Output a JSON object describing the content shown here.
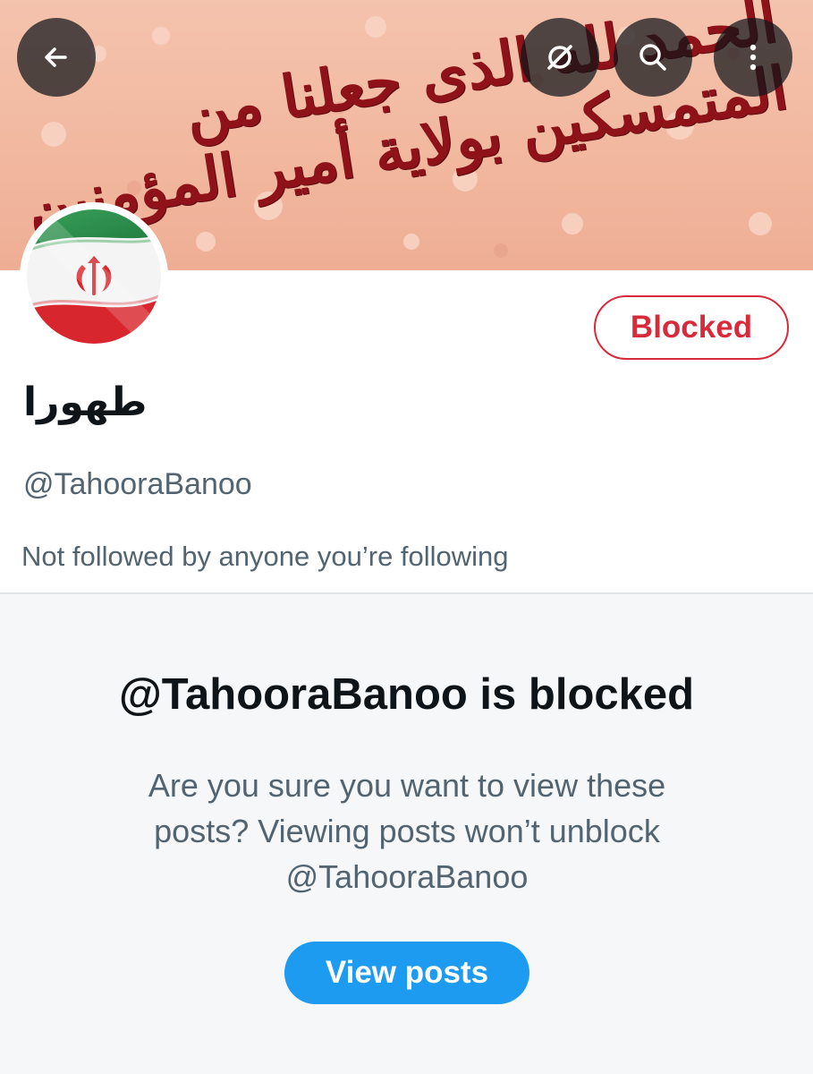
{
  "header": {
    "banner_calligraphy": "الحمد لله الذی جعلنا من المتمسکین بولایة أمیر المؤمنین",
    "icons": [
      "back-arrow-icon",
      "grok-icon",
      "search-icon",
      "more-vertical-icon"
    ]
  },
  "profile": {
    "display_name": "طهورا",
    "handle": "@TahooraBanoo",
    "followed_by": "Not followed by anyone you’re following",
    "blocked_label": "Blocked",
    "avatar": "iran-flag-avatar"
  },
  "blocked_notice": {
    "title": "@TahooraBanoo is blocked",
    "description": "Are you sure you want to view these posts? Viewing posts won’t unblock @TahooraBanoo",
    "button_label": "View posts"
  },
  "colors": {
    "accent": "#1d9bf0",
    "blocked_red": "#d72a3a",
    "secondary_text": "#536471",
    "banner_bg": "#f2b8a0",
    "calligraphy": "#8e1218"
  }
}
